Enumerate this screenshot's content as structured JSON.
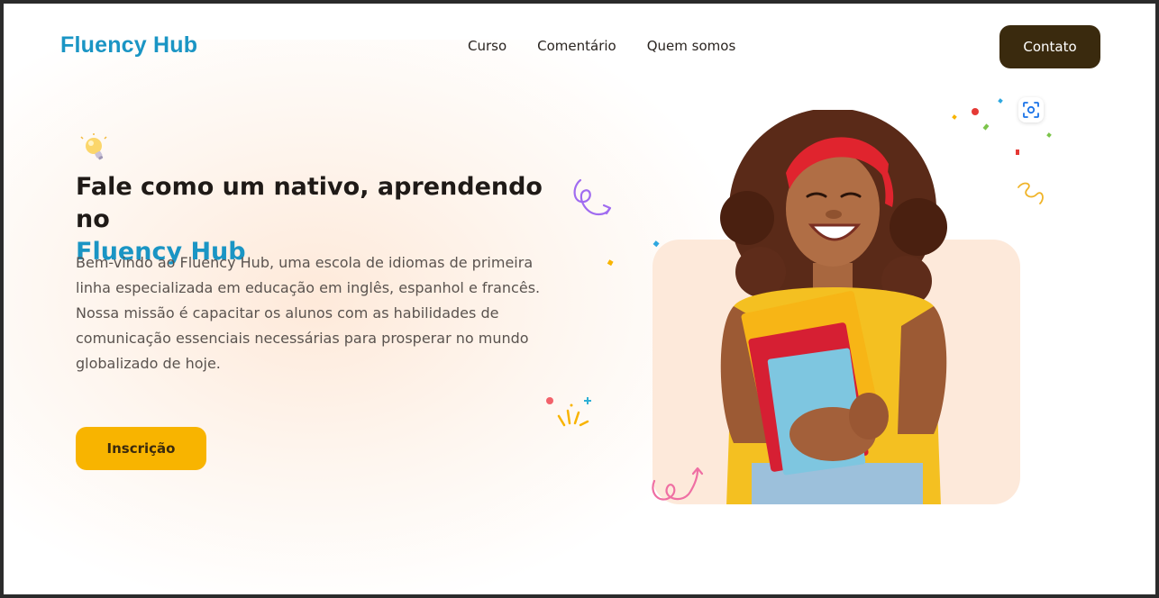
{
  "header": {
    "logo": "Fluency Hub",
    "nav": [
      {
        "label": "Curso"
      },
      {
        "label": "Comentário"
      },
      {
        "label": "Quem somos"
      }
    ],
    "contact_label": "Contato"
  },
  "hero": {
    "title_line1": "Fale como um nativo, aprendendo no",
    "title_accent": "Fluency Hub",
    "description": "Bem-vindo ao Fluency Hub, uma escola de idiomas de primeira linha especializada em educação em inglês, espanhol e francês. Nossa missão é capacitar os alunos com as habilidades de comunicação essenciais necessárias para prosperar no mundo globalizado de hoje.",
    "cta_label": "Inscrição"
  },
  "colors": {
    "brand_blue": "#1a95c4",
    "dark_brown": "#3a2a0e",
    "cta_yellow": "#f8b400",
    "card_peach": "#fde9da"
  },
  "icons": [
    "lightbulb-icon",
    "scan-icon",
    "swirl-icon",
    "confetti-icon",
    "spring-icon"
  ]
}
